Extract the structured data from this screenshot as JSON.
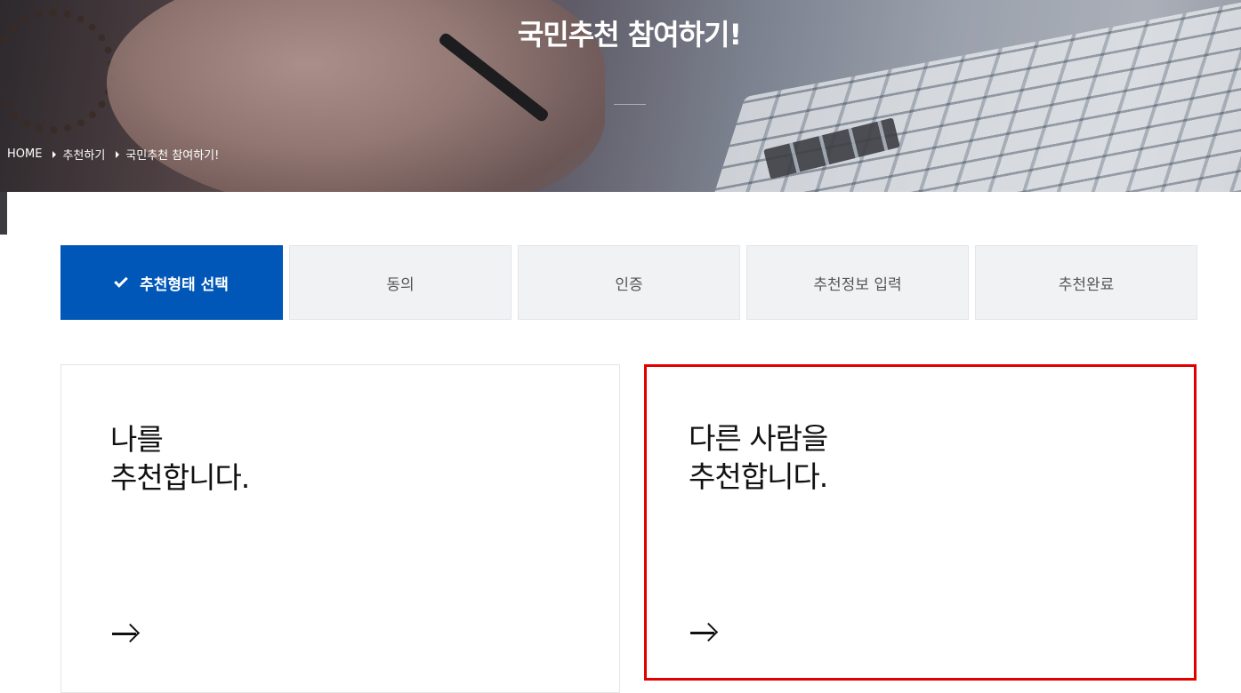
{
  "hero": {
    "title": "국민추천 참여하기!",
    "breadcrumb": [
      "HOME",
      "추천하기",
      "국민추천 참여하기!"
    ]
  },
  "steps": [
    {
      "label": "추천형태 선택",
      "active": true
    },
    {
      "label": "동의",
      "active": false
    },
    {
      "label": "인증",
      "active": false
    },
    {
      "label": "추천정보 입력",
      "active": false
    },
    {
      "label": "추천완료",
      "active": false
    }
  ],
  "cards": [
    {
      "line1": "나를",
      "line2": "추천합니다.",
      "icon": "arrow-right-icon"
    },
    {
      "line1": "다른 사람을",
      "line2": "추천합니다.",
      "icon": "arrow-right-icon",
      "selected": true
    }
  ],
  "colors": {
    "primary": "#0057b8",
    "highlight": "#e00000",
    "step_bg": "#f1f2f4"
  }
}
